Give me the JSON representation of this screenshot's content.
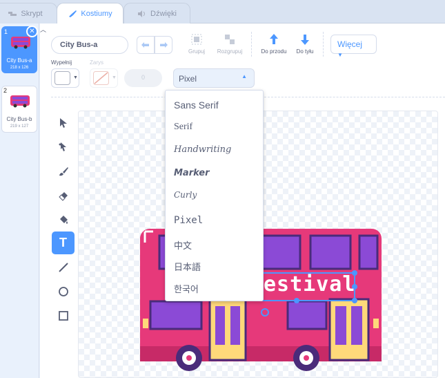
{
  "tabs": [
    {
      "label": "Skrypt",
      "icon": "code-icon"
    },
    {
      "label": "Kostiumy",
      "icon": "brush-icon",
      "active": true
    },
    {
      "label": "Dźwięki",
      "icon": "speaker-icon"
    }
  ],
  "costumes": [
    {
      "number": "1",
      "name": "City Bus-a",
      "size": "218 x 126",
      "selected": true
    },
    {
      "number": "2",
      "name": "City Bus-b",
      "size": "219 x 127",
      "selected": false
    }
  ],
  "toolbar": {
    "costume_name": "City Bus-a",
    "group_label": "Grupuj",
    "ungroup_label": "Rozgrupuj",
    "forward_label": "Do przodu",
    "backward_label": "Do tyłu",
    "more_label": "Więcej"
  },
  "style_row": {
    "fill_label": "Wypełnij",
    "outline_label": "Zarys",
    "outline_width": "0",
    "font_value": "Pixel"
  },
  "font_dropdown": {
    "options": [
      "Sans Serif",
      "Serif",
      "Handwriting",
      "Marker",
      "Curly",
      "Pixel",
      "中文",
      "日本語",
      "한국어"
    ]
  },
  "canvas": {
    "text_object": "estival"
  },
  "colors": {
    "accent": "#4c97ff",
    "bus_body": "#e6397a",
    "bus_window": "#8b4ad6",
    "bus_door": "#ffd97a"
  }
}
